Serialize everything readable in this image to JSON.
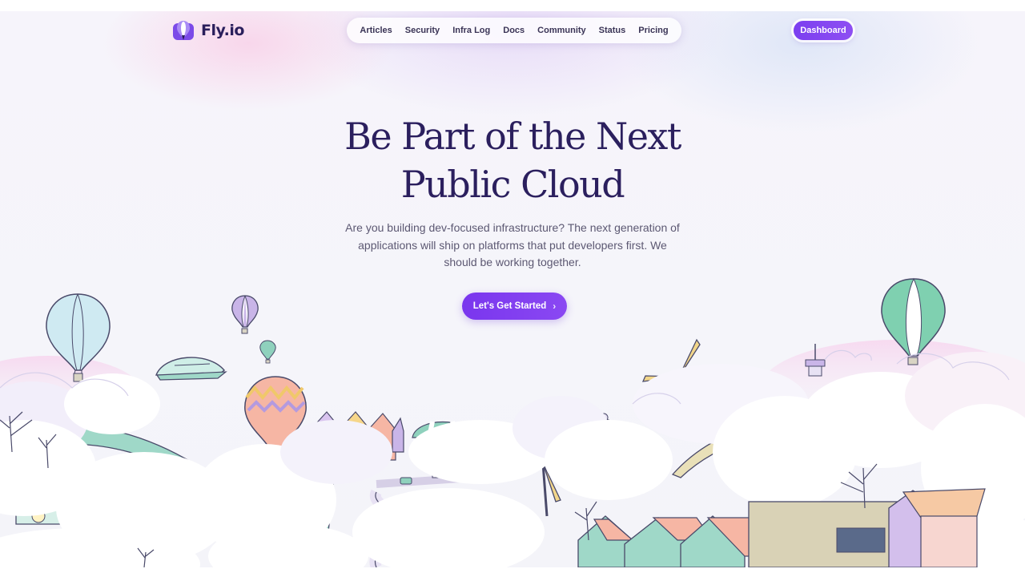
{
  "brand": {
    "name": "Fly.io",
    "logo_icon": "fly-balloon-logo"
  },
  "nav": {
    "items": [
      {
        "label": "Articles"
      },
      {
        "label": "Security"
      },
      {
        "label": "Infra Log"
      },
      {
        "label": "Docs"
      },
      {
        "label": "Community"
      },
      {
        "label": "Status"
      },
      {
        "label": "Pricing"
      }
    ]
  },
  "header": {
    "dashboard_label": "Dashboard"
  },
  "hero": {
    "title_line1": "Be Part of the Next",
    "title_line2": "Public Cloud",
    "subtitle": "Are you building dev-focused infrastructure? The next generation of applications will ship on platforms that put developers first. We should be working together.",
    "cta_label": "Let's Get Started",
    "cta_icon": "chevron-right-icon"
  },
  "colors": {
    "accent": "#7b3ff0",
    "heading": "#2b1f5e",
    "body_text": "#5c5872",
    "background": "#f5f5fa"
  }
}
